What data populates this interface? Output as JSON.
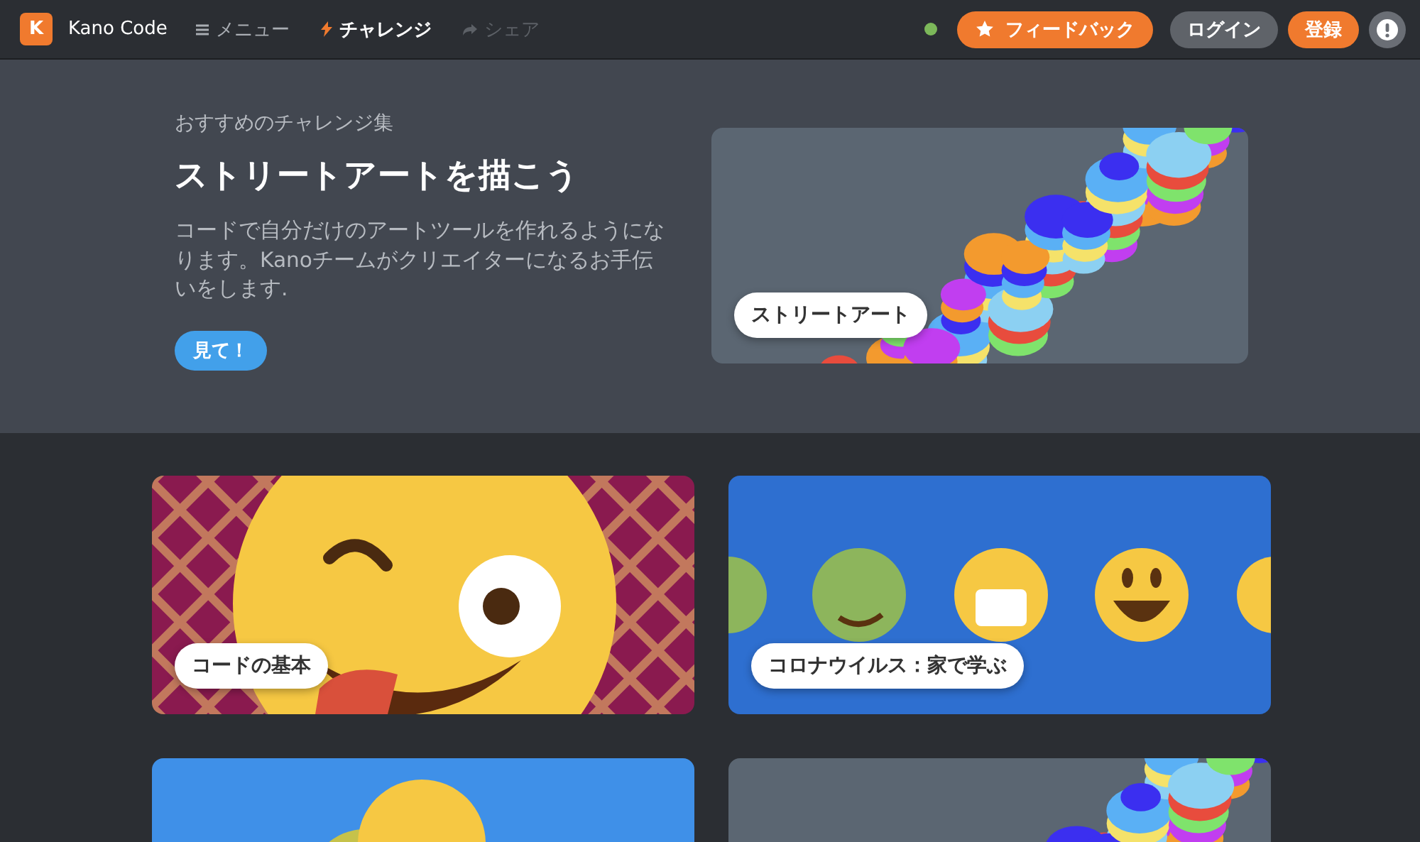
{
  "header": {
    "logo_letter": "K",
    "app_name": "Kano Code",
    "nav": [
      {
        "label": "メニュー",
        "selected": false,
        "disabled": false
      },
      {
        "label": "チャレンジ",
        "selected": true,
        "disabled": false
      },
      {
        "label": "シェア",
        "selected": false,
        "disabled": true
      }
    ],
    "status_online": true,
    "feedback_button": "フィードバック",
    "login_button": "ログイン",
    "signup_button": "登録"
  },
  "featured": {
    "eyebrow": "おすすめのチャレンジ集",
    "title": "ストリートアートを描こう",
    "description": "コードで自分だけのアートツールを作れるようになります。Kanoチームがクリエイターになるお手伝いをします.",
    "button": "見て！",
    "image_label": "ストリートアート"
  },
  "cards": [
    {
      "kind": "plaid-emoji",
      "label": "コードの基本"
    },
    {
      "kind": "emoji-row",
      "label": "コロナウイルス：家で学ぶ"
    },
    {
      "kind": "blue-art"
    },
    {
      "kind": "street-art"
    }
  ]
}
